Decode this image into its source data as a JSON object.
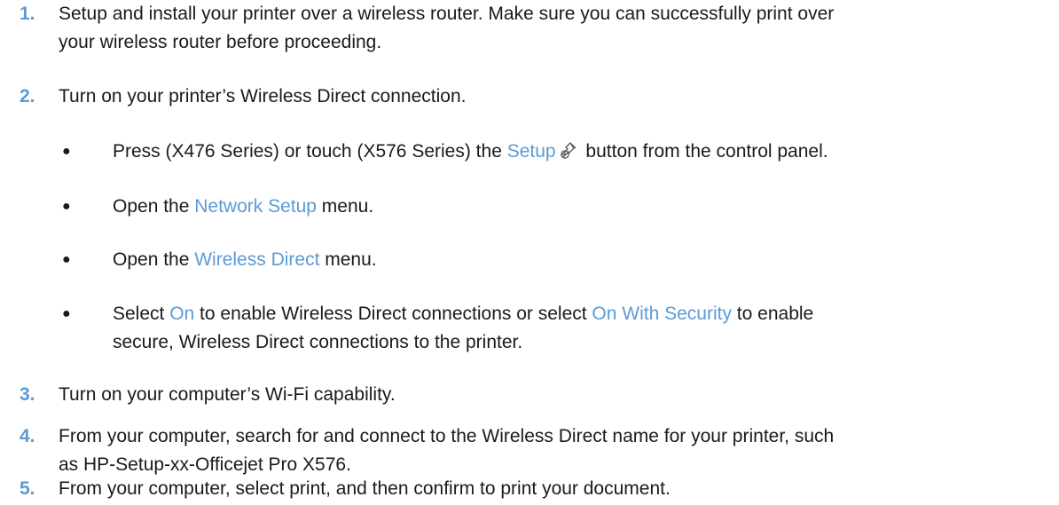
{
  "steps": [
    {
      "num": "1.",
      "line1": "Setup and install your printer over a wireless router. Make sure you can successfully print over",
      "line2": "your wireless router before proceeding."
    },
    {
      "num": "2.",
      "line1": "Turn on your printer’s Wireless Direct connection."
    },
    {
      "num": "3.",
      "line1": "Turn on your computer’s Wi-Fi capability."
    },
    {
      "num": "4.",
      "line1": "From your computer, search for and connect to the Wireless Direct name for your printer, such",
      "line2": "as HP-Setup-xx-Officejet Pro X576."
    },
    {
      "num": "5.",
      "line1": "From your computer, select print, and then confirm to print your document."
    }
  ],
  "bullets": {
    "dot": "●",
    "b1": {
      "pre": "Press (X476 Series) or touch (X576 Series) the ",
      "link": "Setup",
      "icon": "setup-wrench-gear-icon",
      "post": " button from the control panel."
    },
    "b2": {
      "pre": "Open the ",
      "link": "Network Setup",
      "post": " menu."
    },
    "b3": {
      "pre": "Open the ",
      "link": "Wireless Direct",
      "post": " menu."
    },
    "b4": {
      "pre": "Select ",
      "link1": "On",
      "mid": " to enable Wireless Direct connections or select ",
      "link2": "On With Security",
      "post": " to enable",
      "line2": "secure, Wireless Direct connections to the printer."
    }
  },
  "colors": {
    "accent": "#5b9bd5",
    "text": "#1a1a1a"
  }
}
